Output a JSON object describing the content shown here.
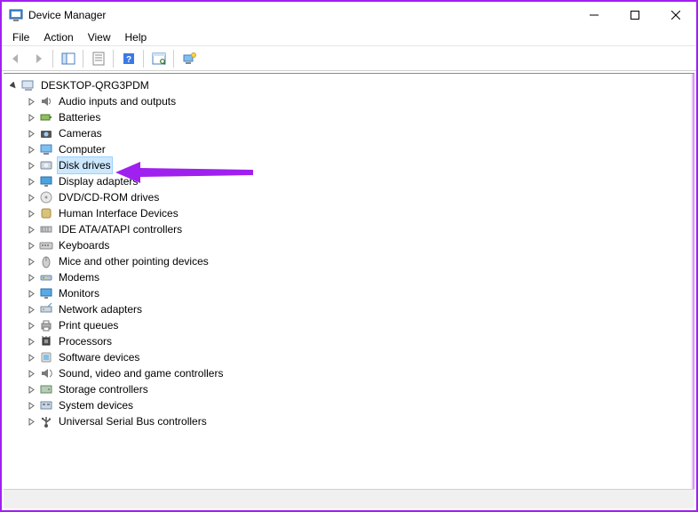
{
  "window": {
    "title": "Device Manager"
  },
  "menu": {
    "file": "File",
    "action": "Action",
    "view": "View",
    "help": "Help"
  },
  "tree": {
    "root": "DESKTOP-QRG3PDM",
    "items": [
      {
        "label": "Audio inputs and outputs",
        "icon": "audio",
        "selected": false
      },
      {
        "label": "Batteries",
        "icon": "battery",
        "selected": false
      },
      {
        "label": "Cameras",
        "icon": "camera",
        "selected": false
      },
      {
        "label": "Computer",
        "icon": "computer",
        "selected": false
      },
      {
        "label": "Disk drives",
        "icon": "disk",
        "selected": true
      },
      {
        "label": "Display adapters",
        "icon": "display",
        "selected": false
      },
      {
        "label": "DVD/CD-ROM drives",
        "icon": "cdrom",
        "selected": false
      },
      {
        "label": "Human Interface Devices",
        "icon": "hid",
        "selected": false
      },
      {
        "label": "IDE ATA/ATAPI controllers",
        "icon": "ide",
        "selected": false
      },
      {
        "label": "Keyboards",
        "icon": "keyboard",
        "selected": false
      },
      {
        "label": "Mice and other pointing devices",
        "icon": "mouse",
        "selected": false
      },
      {
        "label": "Modems",
        "icon": "modem",
        "selected": false
      },
      {
        "label": "Monitors",
        "icon": "monitor",
        "selected": false
      },
      {
        "label": "Network adapters",
        "icon": "network",
        "selected": false
      },
      {
        "label": "Print queues",
        "icon": "printer",
        "selected": false
      },
      {
        "label": "Processors",
        "icon": "cpu",
        "selected": false
      },
      {
        "label": "Software devices",
        "icon": "software",
        "selected": false
      },
      {
        "label": "Sound, video and game controllers",
        "icon": "sound",
        "selected": false
      },
      {
        "label": "Storage controllers",
        "icon": "storage",
        "selected": false
      },
      {
        "label": "System devices",
        "icon": "system",
        "selected": false
      },
      {
        "label": "Universal Serial Bus controllers",
        "icon": "usb",
        "selected": false
      }
    ]
  },
  "annotation": {
    "color": "#a020f0"
  }
}
